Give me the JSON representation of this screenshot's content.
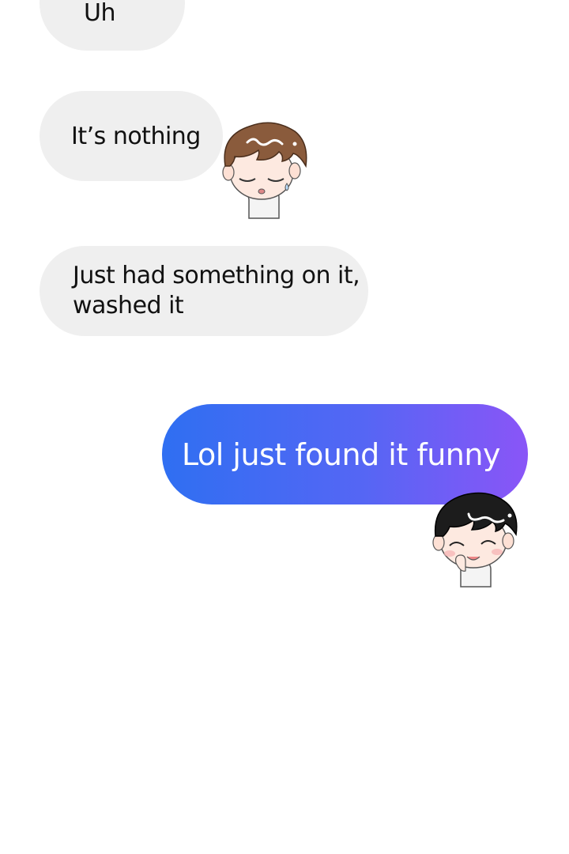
{
  "messages": [
    {
      "side": "in",
      "text": "Uh"
    },
    {
      "side": "in",
      "text": "It’s nothing"
    },
    {
      "side": "in",
      "text_line1": "Just had something on it,",
      "text_line2": "washed it"
    },
    {
      "side": "out",
      "text": "Lol just found it funny"
    }
  ],
  "avatars": [
    {
      "name": "brown-hair-boy-avatar"
    },
    {
      "name": "black-hair-boy-avatar"
    }
  ],
  "colors": {
    "incoming_bubble": "#efefef",
    "outgoing_gradient_start": "#2f6ff2",
    "outgoing_gradient_end": "#8a55f7"
  }
}
